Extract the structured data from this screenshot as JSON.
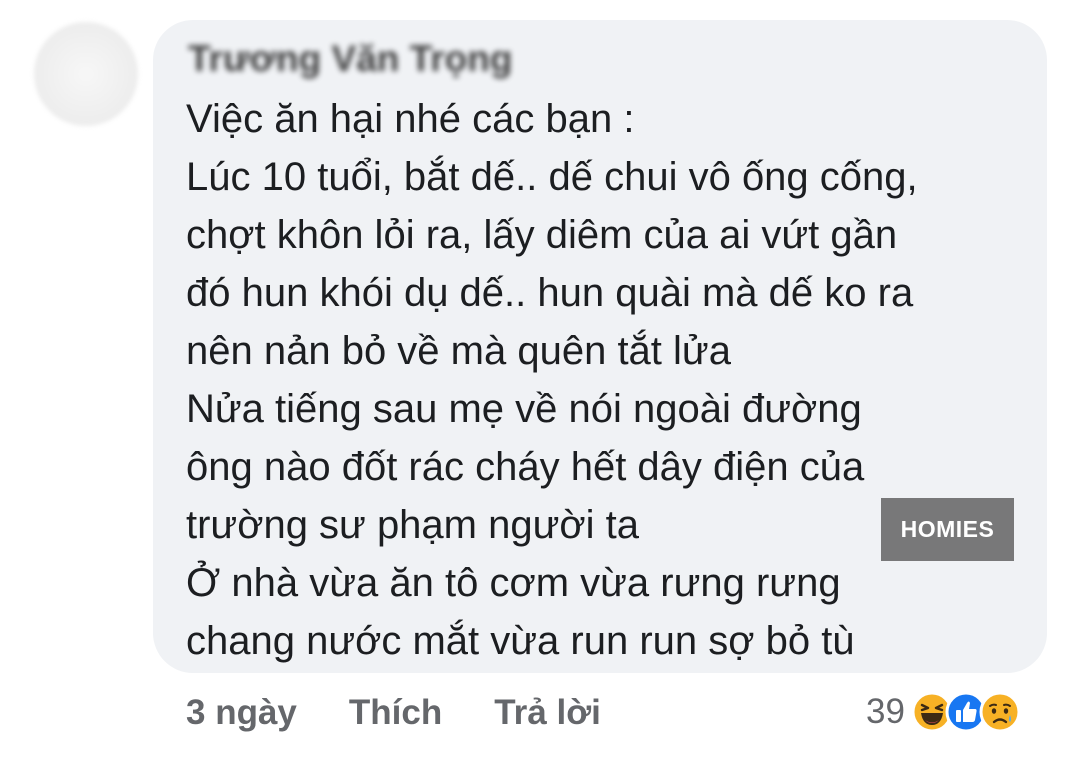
{
  "comment": {
    "author": "Trương Văn Trọng",
    "lines": [
      "Việc ăn hại nhé các bạn :",
      "Lúc 10 tuổi, bắt dế.. dế chui vô ống cống,",
      "chợt khôn lỏi ra, lấy diêm của ai vứt gần",
      "đó hun khói dụ dế.. hun quài mà dế ko ra",
      "nên nản bỏ về mà quên tắt lửa",
      "Nửa tiếng sau mẹ về nói ngoài đường",
      "ông nào đốt rác cháy hết dây điện của",
      "trường sư phạm người ta",
      "Ở nhà vừa ăn tô cơm vừa rưng rưng",
      "chang nước mắt vừa run run sợ bỏ tù"
    ]
  },
  "watermark": "HOMIES",
  "actions": {
    "time": "3 ngày",
    "like": "Thích",
    "reply": "Trả lời"
  },
  "reactions": {
    "count": "39",
    "icons": [
      "haha-icon",
      "like-icon",
      "sad-icon"
    ]
  },
  "colors": {
    "bubble": "#f0f2f5",
    "text": "#1c1e21",
    "meta": "#65676b",
    "like_blue": "#1877f2",
    "emoji_yellow": "#f7b125"
  }
}
